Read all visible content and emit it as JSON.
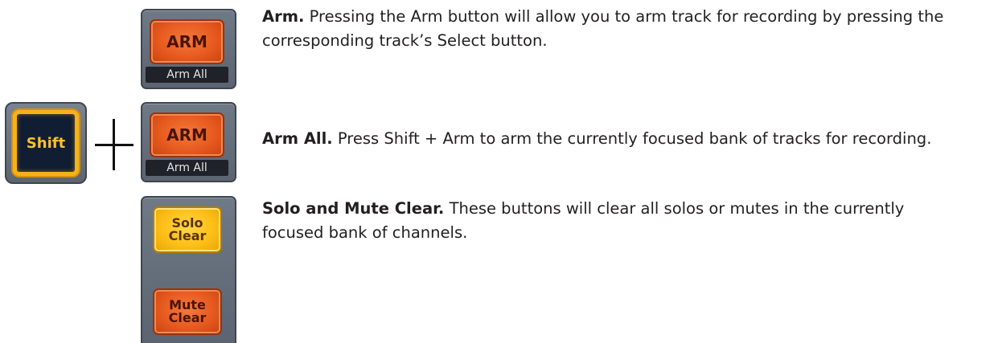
{
  "sections": [
    {
      "term": "Arm.",
      "text": "Pressing the Arm button will allow you to arm track for recording by pressing the corresponding track’s Select button.",
      "button": {
        "label": "ARM",
        "sublabel": "Arm All"
      }
    },
    {
      "term": "Arm All.",
      "text": "Press Shift + Arm to arm the currently focused bank of tracks for recording.",
      "shift_label": "Shift",
      "button": {
        "label": "ARM",
        "sublabel": "Arm All"
      }
    },
    {
      "term": "Solo and Mute Clear.",
      "text": "These buttons will clear all solos or mutes in the currently focused bank of channels.",
      "solo_clear": {
        "line1": "Solo",
        "line2": "Clear"
      },
      "mute_clear": {
        "line1": "Mute",
        "line2": "Clear"
      }
    }
  ],
  "colors": {
    "arm_button": "#e75a1f",
    "solo_button": "#fdbf17",
    "shift_key_face": "#111d33",
    "shift_key_glow": "#f6b21a",
    "panel": "#5b6470"
  }
}
